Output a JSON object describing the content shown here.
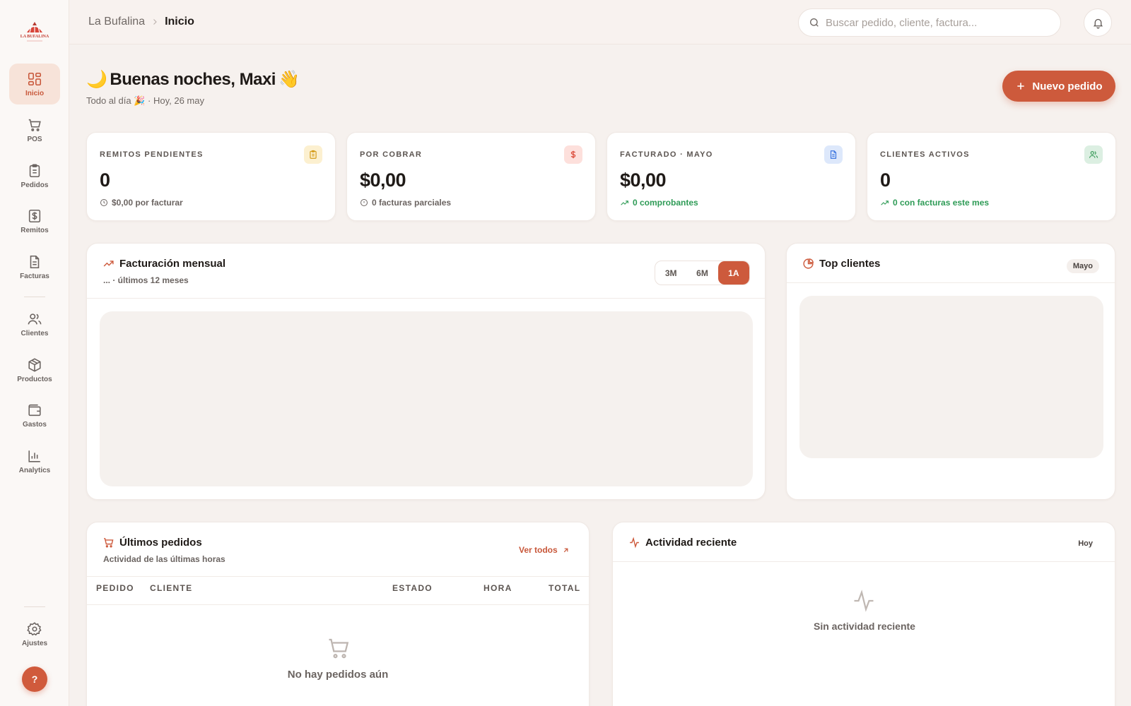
{
  "app": {
    "logo_text": "LA BUFALINA"
  },
  "breadcrumb": {
    "root": "La Bufalina",
    "current": "Inicio"
  },
  "search": {
    "placeholder": "Buscar pedido, cliente, factura..."
  },
  "sidebar": {
    "items": [
      {
        "label": "Inicio",
        "icon": "grid-icon",
        "active": true
      },
      {
        "label": "POS",
        "icon": "cart-icon"
      },
      {
        "label": "Pedidos",
        "icon": "clipboard-icon"
      },
      {
        "label": "Remitos",
        "icon": "dollar-doc-icon"
      },
      {
        "label": "Facturas",
        "icon": "file-text-icon"
      },
      {
        "label": "Clientes",
        "icon": "users-icon"
      },
      {
        "label": "Productos",
        "icon": "box-icon"
      },
      {
        "label": "Gastos",
        "icon": "wallet-icon"
      },
      {
        "label": "Analytics",
        "icon": "bar-chart-icon"
      }
    ],
    "settings_label": "Ajustes",
    "help_label": "?"
  },
  "greeting": {
    "title": "Buenas noches, Maxi",
    "emoji_moon": "🌙",
    "emoji_wave": "👋",
    "sub_status": "Todo al día",
    "sub_emoji": "🎉",
    "sub_date": "· Hoy, 26 may"
  },
  "actions": {
    "new_order_label": "Nuevo pedido"
  },
  "kpis": [
    {
      "title": "REMITOS PENDIENTES",
      "value": "0",
      "foot": "$0,00 por facturar",
      "icon": "clipboard-icon",
      "color": "#e8b43a"
    },
    {
      "title": "POR COBRAR",
      "value": "$0,00",
      "foot": "0 facturas parciales",
      "icon": "dollar-icon",
      "color": "#e0483c"
    },
    {
      "title": "FACTURADO · MAYO",
      "value": "$0,00",
      "foot": "0 comprobantes",
      "icon": "document-icon",
      "color": "#3a74e0"
    },
    {
      "title": "CLIENTES ACTIVOS",
      "value": "0",
      "foot": "0 con facturas este mes",
      "icon": "users-icon",
      "color": "#3a9b5a"
    }
  ],
  "billing": {
    "title": "Facturación mensual",
    "subtitle": "... · últimos 12 meses",
    "ranges": [
      "3M",
      "6M",
      "1A"
    ],
    "active_range": "1A"
  },
  "top_clients": {
    "title": "Top clientes",
    "badge": "Mayo"
  },
  "orders": {
    "title": "Últimos pedidos",
    "subtitle": "Actividad de las últimas horas",
    "view_all": "Ver todos",
    "columns": [
      "PEDIDO",
      "CLIENTE",
      "ESTADO",
      "HORA",
      "TOTAL"
    ],
    "empty": "No hay pedidos aún"
  },
  "activity": {
    "title": "Actividad reciente",
    "badge": "Hoy",
    "empty": "Sin actividad reciente"
  },
  "colors": {
    "accent": "#cd5a3c",
    "positive": "#2e9b56"
  }
}
